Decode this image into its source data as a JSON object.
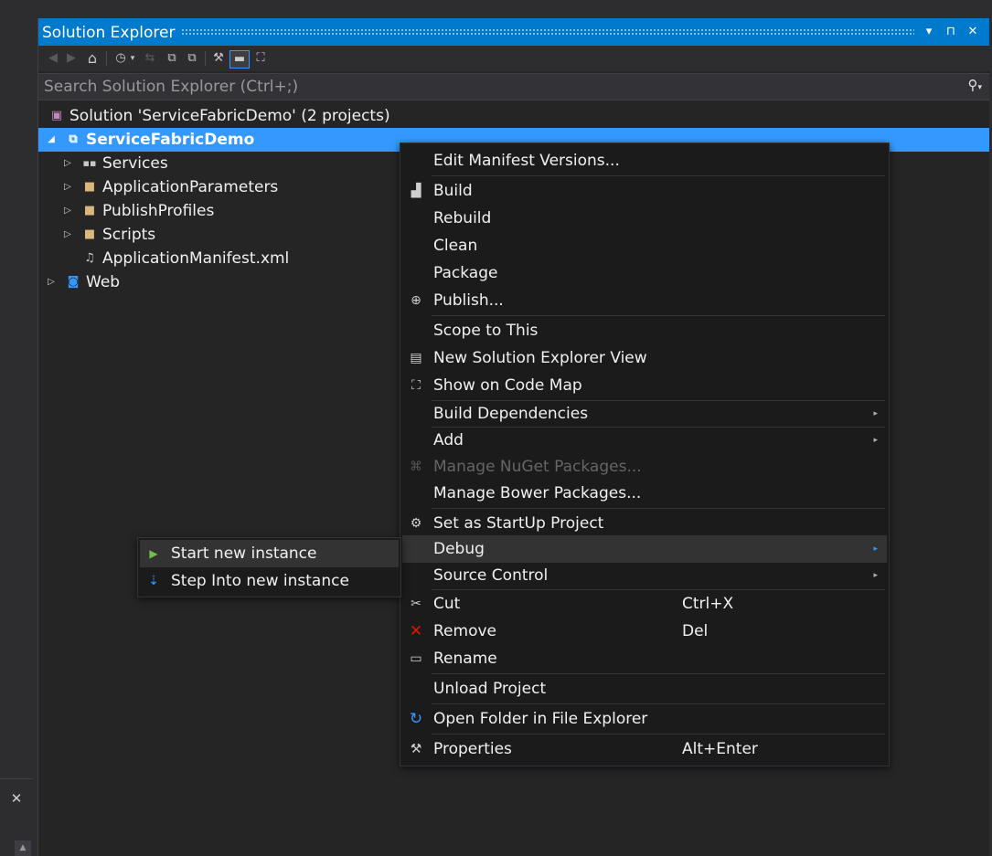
{
  "window": {
    "title": "Solution Explorer",
    "buttons": {
      "dropdown": "▾",
      "pin": "⊓",
      "close": "✕"
    }
  },
  "toolbar": {
    "back": "◀",
    "forward": "▶",
    "home": "⌂",
    "history": "◷",
    "history_drop": "▾",
    "sync": "⇆",
    "collapse": "⧉",
    "show_all": "⧉",
    "properties": "⚒",
    "preview": "▬",
    "code_map": "⛶"
  },
  "search": {
    "placeholder": "Search Solution Explorer (Ctrl+;)",
    "icon": "⚲",
    "drop": "▾"
  },
  "tree": {
    "solution": "Solution 'ServiceFabricDemo' (2 projects)",
    "project": "ServiceFabricDemo",
    "children": [
      "Services",
      "ApplicationParameters",
      "PublishProfiles",
      "Scripts",
      "ApplicationManifest.xml"
    ],
    "web": "Web"
  },
  "context_menu": {
    "edit_manifest": "Edit Manifest Versions...",
    "build": "Build",
    "rebuild": "Rebuild",
    "clean": "Clean",
    "package": "Package",
    "publish": "Publish...",
    "scope": "Scope to This",
    "new_view": "New Solution Explorer View",
    "code_map": "Show on Code Map",
    "build_deps": "Build Dependencies",
    "add": "Add",
    "nuget": "Manage NuGet Packages...",
    "bower": "Manage Bower Packages...",
    "startup": "Set as StartUp Project",
    "debug": "Debug",
    "source_control": "Source Control",
    "cut": "Cut",
    "cut_sc": "Ctrl+X",
    "remove": "Remove",
    "remove_sc": "Del",
    "rename": "Rename",
    "unload": "Unload Project",
    "open_folder": "Open Folder in File Explorer",
    "properties": "Properties",
    "properties_sc": "Alt+Enter",
    "submenu_arrow": "▸"
  },
  "debug_submenu": {
    "start": "Start new instance",
    "step_into": "Step Into new instance"
  },
  "colors": {
    "accent": "#007acc",
    "selection": "#3399ff",
    "remove_icon": "#e51400"
  }
}
